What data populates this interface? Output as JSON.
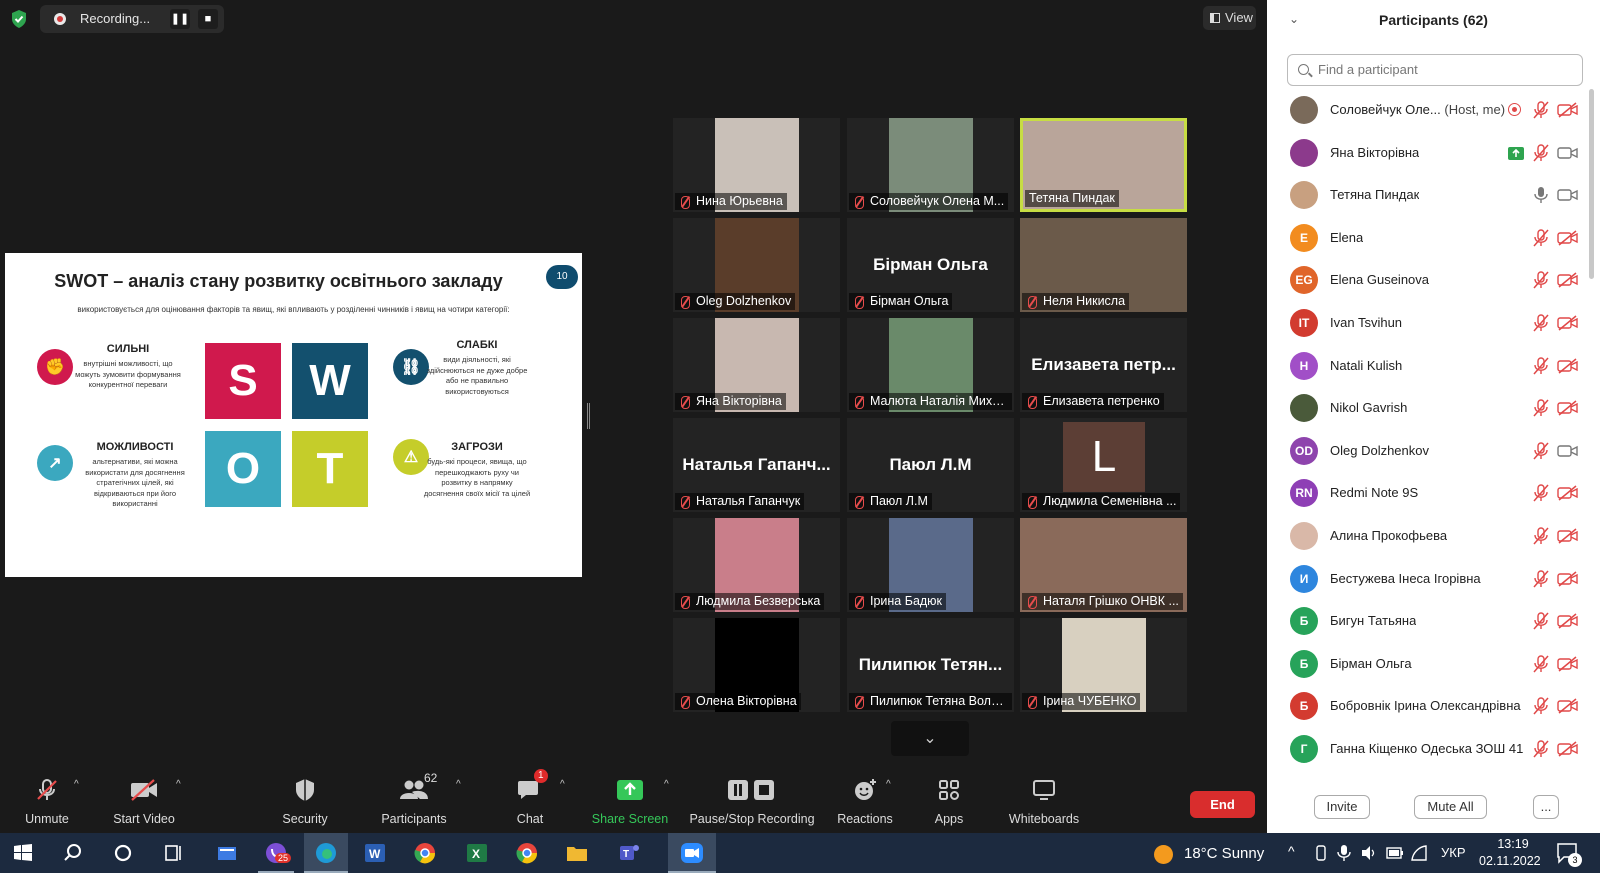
{
  "recording": {
    "label": "Recording..."
  },
  "view_button": {
    "label": "View"
  },
  "slide": {
    "title": "SWOT – аналіз стану розвитку освітнього закладу",
    "number": "10",
    "subtitle": "використовується для оцінювання факторів та явищ, які впливають у розділенні чинників і явищ на чотири категорії:",
    "letters": [
      "S",
      "W",
      "O",
      "T"
    ],
    "categories": [
      {
        "title": "СИЛЬНІ",
        "text": "внутрішні можливості, що можуть зумовити формування конкурентної переваги"
      },
      {
        "title": "СЛАБКІ",
        "text": "види діяльності, які здійснюються не дуже добре або не правильно використовуються"
      },
      {
        "title": "МОЖЛИВОСТІ",
        "text": "альтернативи, які можна використати для досягнення стратегічних цілей, які відкриваються при його використанні"
      },
      {
        "title": "ЗАГРОЗИ",
        "text": "будь-які процеси, явища, що перешкоджають руху чи розвитку в напрямку досягнення своїх місії та цілей"
      }
    ],
    "colors": {
      "S": "#d0194d",
      "W": "#13506e",
      "O": "#3ba8bf",
      "T": "#c5cd2a"
    }
  },
  "tiles": [
    {
      "name": "Нина Юрьевна",
      "big": "",
      "muted": true
    },
    {
      "name": "Соловейчук Олена М...",
      "big": "",
      "muted": true
    },
    {
      "name": "Тетяна Пиндак",
      "big": "",
      "muted": false,
      "active": true
    },
    {
      "name": "Oleg Dolzhenkov",
      "big": "",
      "muted": true
    },
    {
      "name": "Бірман Ольга",
      "big": "Бірман Ольга",
      "muted": true
    },
    {
      "name": "Неля Никисла",
      "big": "",
      "muted": true
    },
    {
      "name": "Яна Вікторівна",
      "big": "",
      "muted": true
    },
    {
      "name": "Малюта Наталія Миха...",
      "big": "",
      "muted": true
    },
    {
      "name": "Елизавета петренко",
      "big": "Елизавета петр...",
      "muted": true
    },
    {
      "name": "Наталья Гапанчук",
      "big": "Наталья Гапанч...",
      "muted": true
    },
    {
      "name": "Паюл Л.М",
      "big": "Паюл Л.М",
      "muted": true
    },
    {
      "name": "Людмила Семенівна ...",
      "big": "",
      "avatar": "L",
      "muted": true
    },
    {
      "name": "Людмила  Безверська",
      "big": "",
      "muted": true
    },
    {
      "name": "Ірина  Бадюк",
      "big": "",
      "muted": true
    },
    {
      "name": "Наталя Грішко ОНВК ...",
      "big": "",
      "muted": true
    },
    {
      "name": "Олена Вікторівна",
      "big": "",
      "muted": true
    },
    {
      "name": "Пилипюк Тетяна Воло...",
      "big": "Пилипюк Тетян...",
      "muted": true
    },
    {
      "name": "Ірина ЧУБЕНКО",
      "big": "",
      "muted": true
    }
  ],
  "toolbar": {
    "unmute": "Unmute",
    "start_video": "Start Video",
    "security": "Security",
    "participants": "Participants",
    "participants_count": "62",
    "chat": "Chat",
    "chat_badge": "1",
    "share_screen": "Share Screen",
    "pause_stop": "Pause/Stop Recording",
    "reactions": "Reactions",
    "apps": "Apps",
    "whiteboards": "Whiteboards",
    "end": "End"
  },
  "participants_panel": {
    "title": "Participants (62)",
    "search_placeholder": "Find a participant",
    "items": [
      {
        "name": "Соловейчук Оле...",
        "tag": "(Host, me)",
        "initials": "",
        "color": "#7a6a5a",
        "mic": "muted",
        "cam": "off",
        "rec": true
      },
      {
        "name": "Яна Вікторівна",
        "tag": "",
        "initials": "",
        "color": "#8c3a8c",
        "mic": "muted",
        "cam": "on",
        "share": true
      },
      {
        "name": "Тетяна Пиндак",
        "tag": "",
        "initials": "",
        "color": "#c8a080",
        "mic": "on",
        "cam": "on"
      },
      {
        "name": "Elena",
        "tag": "",
        "initials": "E",
        "color": "#f28c1f",
        "mic": "muted",
        "cam": "off"
      },
      {
        "name": "Elena Guseinova",
        "tag": "",
        "initials": "EG",
        "color": "#e0652a",
        "mic": "muted",
        "cam": "off"
      },
      {
        "name": "Ivan Tsvihun",
        "tag": "",
        "initials": "IT",
        "color": "#d23b2f",
        "mic": "muted",
        "cam": "off"
      },
      {
        "name": "Natali Kulish",
        "tag": "",
        "initials": "H",
        "color": "#a14fc7",
        "mic": "muted",
        "cam": "off"
      },
      {
        "name": "Nikol Gavrish",
        "tag": "",
        "initials": "",
        "color": "#4a5a3a",
        "mic": "muted",
        "cam": "off"
      },
      {
        "name": "Oleg Dolzhenkov",
        "tag": "",
        "initials": "OD",
        "color": "#8e44ad",
        "mic": "muted",
        "cam": "on"
      },
      {
        "name": "Redmi Note 9S",
        "tag": "",
        "initials": "RN",
        "color": "#8e3fb5",
        "mic": "muted",
        "cam": "off"
      },
      {
        "name": "Алина Прокофьева",
        "tag": "",
        "initials": "",
        "color": "#d9b8a8",
        "mic": "muted",
        "cam": "off"
      },
      {
        "name": "Бестужева Інеса Ігорівна",
        "tag": "",
        "initials": "И",
        "color": "#2e86de",
        "mic": "muted",
        "cam": "off"
      },
      {
        "name": "Бигун Татьяна",
        "tag": "",
        "initials": "Б",
        "color": "#27a35a",
        "mic": "muted",
        "cam": "off"
      },
      {
        "name": "Бірман Ольга",
        "tag": "",
        "initials": "Б",
        "color": "#27a35a",
        "mic": "muted",
        "cam": "off"
      },
      {
        "name": "Бобровнік Ірина Олександрівна",
        "tag": "",
        "initials": "Б",
        "color": "#d33b30",
        "mic": "muted",
        "cam": "off"
      },
      {
        "name": "Ганна Кіщенко Одеська ЗОШ 41",
        "tag": "",
        "initials": "Г",
        "color": "#27a35a",
        "mic": "muted",
        "cam": "off"
      }
    ],
    "invite": "Invite",
    "mute_all": "Mute All",
    "more": "..."
  },
  "taskbar": {
    "weather": "18°C  Sunny",
    "lang": "УКР",
    "time": "13:19",
    "date": "02.11.2022",
    "viber_badge": "25",
    "notif_count": "3"
  }
}
